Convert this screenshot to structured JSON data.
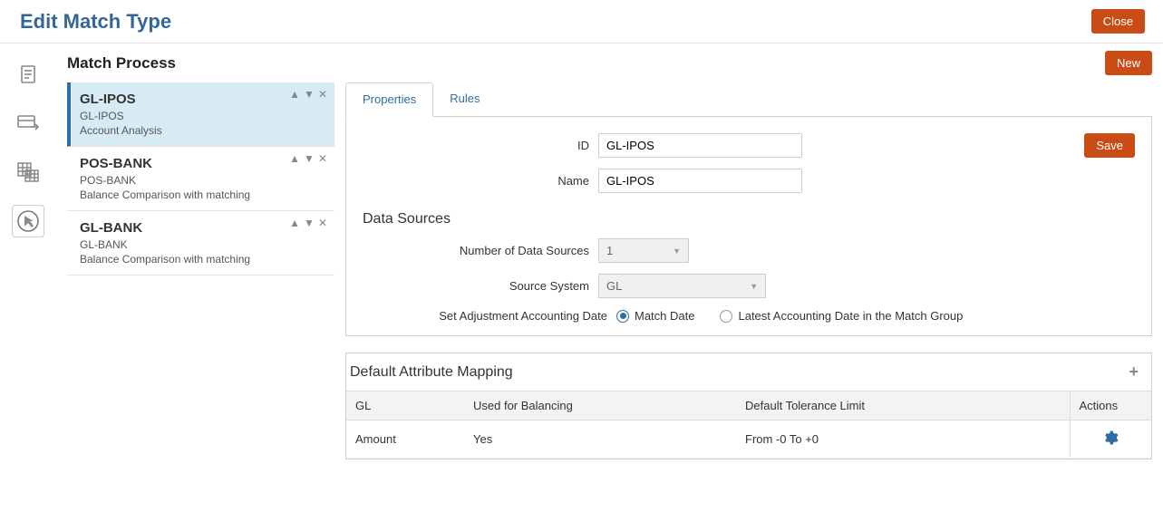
{
  "header": {
    "title": "Edit Match Type",
    "close_label": "Close"
  },
  "sidebar_icons": [
    "doc",
    "transfer",
    "grid",
    "cursor"
  ],
  "main": {
    "section_title": "Match Process",
    "new_label": "New",
    "processes": [
      {
        "title": "GL-IPOS",
        "sub": "GL-IPOS",
        "detail": "Account Analysis",
        "selected": true
      },
      {
        "title": "POS-BANK",
        "sub": "POS-BANK",
        "detail": "Balance Comparison with matching",
        "selected": false
      },
      {
        "title": "GL-BANK",
        "sub": "GL-BANK",
        "detail": "Balance Comparison with matching",
        "selected": false
      }
    ],
    "tabs": {
      "properties": "Properties",
      "rules": "Rules"
    },
    "save_label": "Save",
    "form": {
      "id_label": "ID",
      "id_value": "GL-IPOS",
      "name_label": "Name",
      "name_value": "GL-IPOS",
      "ds_title": "Data Sources",
      "num_ds_label": "Number of Data Sources",
      "num_ds_value": "1",
      "source_system_label": "Source System",
      "source_system_value": "GL",
      "adj_date_label": "Set Adjustment Accounting Date",
      "adj_opt1": "Match Date",
      "adj_opt2": "Latest Accounting Date in the Match Group"
    },
    "mapping": {
      "title": "Default Attribute Mapping",
      "columns": {
        "c1": "GL",
        "c2": "Used for Balancing",
        "c3": "Default Tolerance Limit",
        "c4": "Actions"
      },
      "rows": [
        {
          "c1": "Amount",
          "c2": "Yes",
          "c3": "From -0 To +0"
        }
      ]
    }
  }
}
